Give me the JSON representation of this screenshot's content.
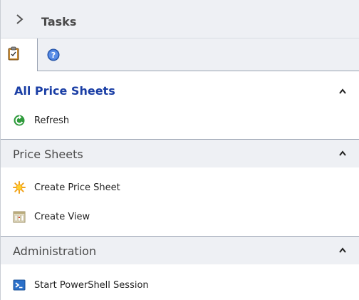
{
  "header": {
    "title": "Tasks",
    "chevron_icon": "chevron-right-icon"
  },
  "tabs": [
    {
      "icon": "clipboard-checklist-icon"
    },
    {
      "icon": "help-icon"
    }
  ],
  "primary_section": {
    "title": "All Price Sheets",
    "actions": [
      {
        "label": "Refresh",
        "icon": "refresh-icon"
      }
    ]
  },
  "groups": [
    {
      "title": "Price Sheets",
      "actions": [
        {
          "label": "Create Price Sheet",
          "icon": "starburst-icon"
        },
        {
          "label": "Create View",
          "icon": "view-icon"
        }
      ]
    },
    {
      "title": "Administration",
      "actions": [
        {
          "label": "Start PowerShell Session",
          "icon": "powershell-icon"
        }
      ]
    }
  ],
  "colors": {
    "accent": "#1a3ea5",
    "panel_bg": "#eef0f4",
    "divider": "#9aa3b2"
  }
}
